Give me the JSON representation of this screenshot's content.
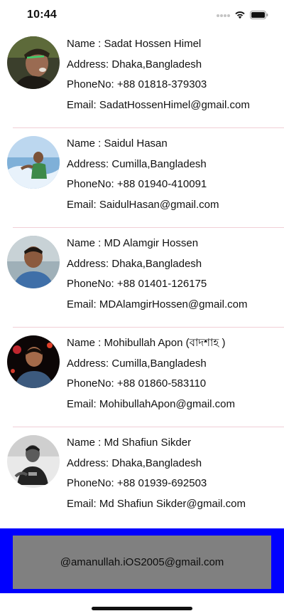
{
  "status_bar": {
    "time": "10:44",
    "icons": [
      "signal-dots-icon",
      "wifi-icon",
      "battery-icon"
    ]
  },
  "contacts": [
    {
      "name": "Name : Sadat Hossen Himel",
      "address": "Address: Dhaka,Bangladesh",
      "phone": "PhoneNo: +88 01818-379303",
      "email": "Email: SadatHossenHimel@gmail.com",
      "avatar": "profile-photo-icon"
    },
    {
      "name": "Name : Saidul Hasan",
      "address": "Address: Cumilla,Bangladesh",
      "phone": "PhoneNo: +88 01940-410091",
      "email": "Email: SaidulHasan@gmail.com",
      "avatar": "profile-photo-icon"
    },
    {
      "name": "Name : MD Alamgir Hossen",
      "address": "Address: Dhaka,Bangladesh",
      "phone": "PhoneNo: +88 01401-126175",
      "email": "Email: MDAlamgirHossen@gmail.com",
      "avatar": "profile-photo-icon"
    },
    {
      "name": "Name : Mohibullah Apon (বাদশাহ )",
      "address": "Address: Cumilla,Bangladesh",
      "phone": "PhoneNo: +88 01860-583110",
      "email": "Email: MohibullahApon@gmail.com",
      "avatar": "profile-photo-icon"
    },
    {
      "name": "Name : Md Shafiun Sikder",
      "address": "Address: Dhaka,Bangladesh",
      "phone": "PhoneNo: +88 01939-692503",
      "email": "Email: Md Shafiun Sikder@gmail.com",
      "avatar": "profile-photo-icon"
    }
  ],
  "footer": {
    "email": "@amanullah.iOS2005@gmail.com"
  },
  "colors": {
    "footer_band": "#0000ff",
    "footer_panel": "#808080",
    "divider": "#f1cfd6"
  }
}
